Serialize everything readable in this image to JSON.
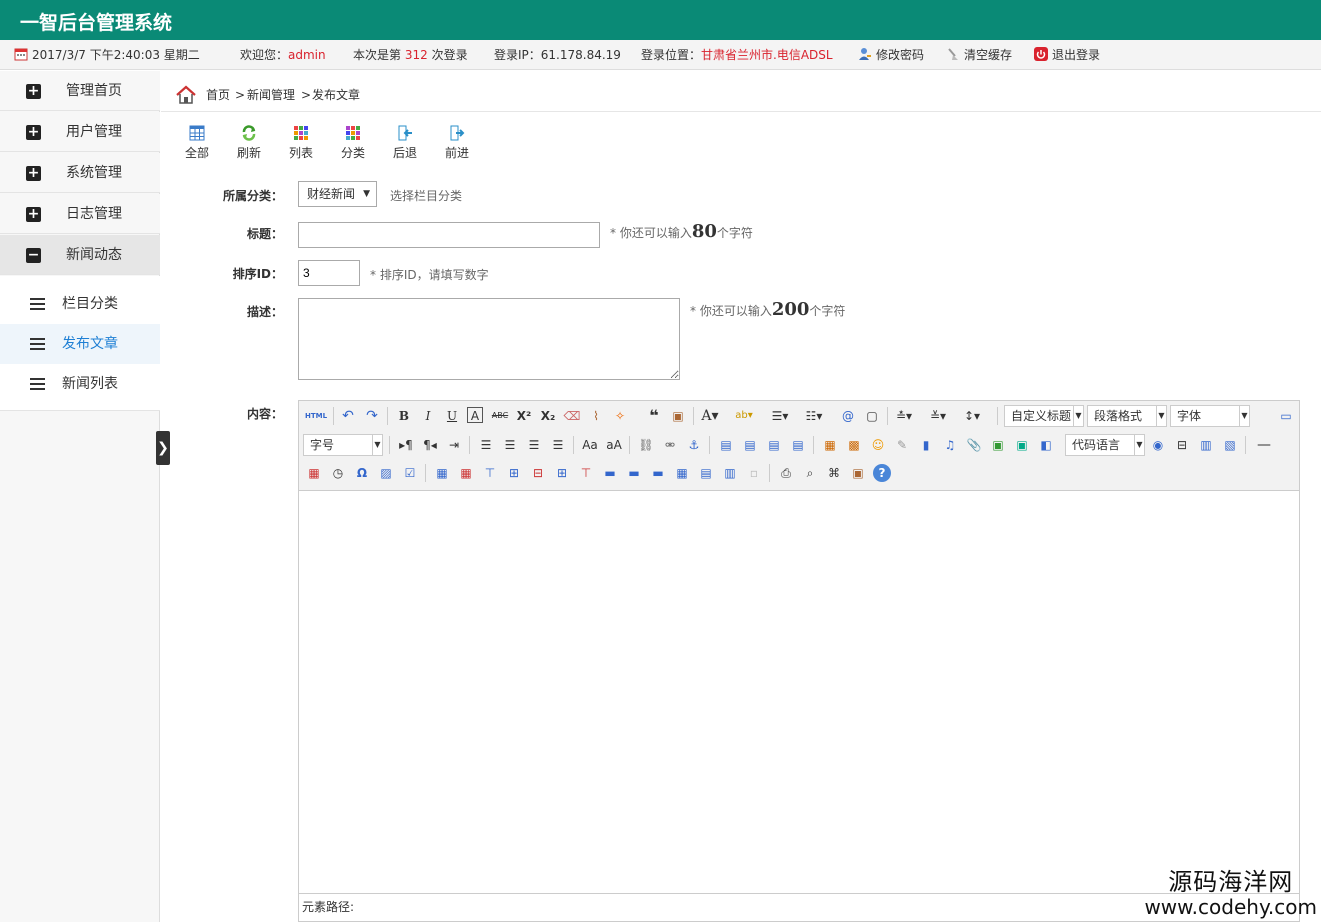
{
  "app": {
    "title": "一智后台管理系统"
  },
  "infobar": {
    "datetime": "2017/3/7 下午2:40:03 星期二",
    "welcome_prefix": "欢迎您：",
    "username": "admin",
    "login_prefix": "本次是第",
    "login_count": "312",
    "login_suffix": "次登录",
    "ip_label": "登录IP：61.178.84.19",
    "location_prefix": "登录位置：",
    "location": "甘肃省兰州市.电信ADSL",
    "change_password": "修改密码",
    "clear_cache": "清空缓存",
    "logout": "退出登录"
  },
  "sidebar": {
    "items": [
      {
        "label": "管理首页",
        "sign": "+"
      },
      {
        "label": "用户管理",
        "sign": "+"
      },
      {
        "label": "系统管理",
        "sign": "+"
      },
      {
        "label": "日志管理",
        "sign": "+"
      },
      {
        "label": "新闻动态",
        "sign": "−"
      }
    ],
    "subitems": [
      {
        "label": "栏目分类"
      },
      {
        "label": "发布文章"
      },
      {
        "label": "新闻列表"
      }
    ],
    "collapse": "❯"
  },
  "breadcrumb": {
    "home": "首页",
    "sep1": ">",
    "section": "新闻管理",
    "sep2": ">",
    "page": "发布文章"
  },
  "toolbar": {
    "all": "全部",
    "refresh": "刷新",
    "list": "列表",
    "category": "分类",
    "back": "后退",
    "forward": "前进"
  },
  "form": {
    "category_label": "所属分类：",
    "category_value": "财经新闻",
    "category_hint": "选择栏目分类",
    "title_label": "标题：",
    "title_value": "",
    "title_hint_prefix": "* 你还可以输入",
    "title_hint_num": "80",
    "title_hint_suffix": "个字符",
    "sort_label": "排序ID：",
    "sort_value": "3",
    "sort_hint": "* 排序ID，请填写数字",
    "desc_label": "描述：",
    "desc_value": "",
    "desc_hint_prefix": "* 你还可以输入",
    "desc_hint_num": "200",
    "desc_hint_suffix": "个字符",
    "content_label": "内容："
  },
  "editor": {
    "combo_heading": "自定义标题",
    "combo_paragraph": "段落格式",
    "combo_font": "字体",
    "combo_size": "字号",
    "combo_codelang": "代码语言",
    "html_btn": "HTML",
    "status_label": "元素路径:"
  },
  "watermark": {
    "cn": "源码海洋网",
    "url": "www.codehy.com"
  },
  "colors": {
    "topbar": "#0a8a76",
    "accent_red": "#d9232e",
    "active_blue": "#1e7fd4"
  }
}
